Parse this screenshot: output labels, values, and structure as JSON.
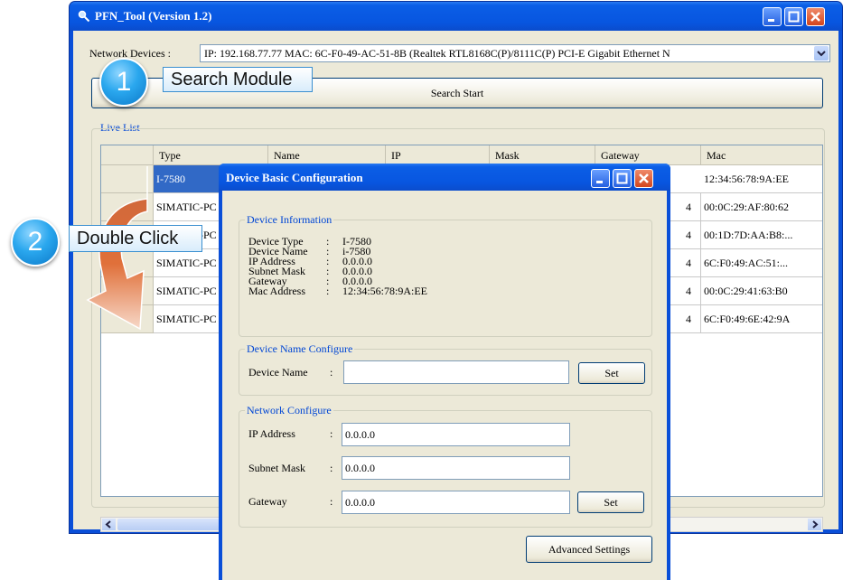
{
  "main_window": {
    "title": "PFN_Tool (Version 1.2)",
    "network_devices_label": "Network Devices :",
    "network_devices_value": "IP: 192.168.77.77  MAC: 6C-F0-49-AC-51-8B (Realtek RTL8168C(P)/8111C(P) PCI-E Gigabit Ethernet N",
    "search_button": "Search Start",
    "live_list_label": "Live List",
    "columns": [
      "Type",
      "Name",
      "IP",
      "Mask",
      "Gateway",
      "Mac"
    ],
    "rows": [
      {
        "type": "I-7580",
        "mac": "12:34:56:78:9A:EE",
        "gw_frag": ""
      },
      {
        "type": "SIMATIC-PC",
        "mac": "00:0C:29:AF:80:62",
        "gw_frag": "4"
      },
      {
        "type": "SIMATIC-PC",
        "mac": "00:1D:7D:AA:B8:...",
        "gw_frag": "4"
      },
      {
        "type": "SIMATIC-PC",
        "mac": "6C:F0:49:AC:51:...",
        "gw_frag": "4"
      },
      {
        "type": "SIMATIC-PC",
        "mac": "00:0C:29:41:63:B0",
        "gw_frag": "4"
      },
      {
        "type": "SIMATIC-PC",
        "mac": "6C:F0:49:6E:42:9A",
        "gw_frag": "4"
      }
    ]
  },
  "dialog": {
    "title": "Device Basic Configuration",
    "device_info_title": "Device Information",
    "info_labels": [
      "Device Type",
      "Device Name",
      "IP Address",
      "Subnet Mask",
      "Gateway",
      "Mac Address"
    ],
    "info_values": [
      "I-7580",
      "i-7580",
      "0.0.0.0",
      "0.0.0.0",
      "0.0.0.0",
      "12:34:56:78:9A:EE"
    ],
    "name_group_title": "Device Name Configure",
    "device_name_label": "Device Name",
    "device_name_value": "",
    "set_label": "Set",
    "network_group_title": "Network Configure",
    "ip_label": "IP Address",
    "ip_value": "0.0.0.0",
    "mask_label": "Subnet Mask",
    "mask_value": "0.0.0.0",
    "gateway_label": "Gateway",
    "gateway_value": "0.0.0.0",
    "advanced_label": "Advanced Settings",
    "colon": ":"
  },
  "annotations": {
    "step1_number": "1",
    "step1_text": "Search Module",
    "step2_number": "2",
    "step2_text": "Double Click"
  },
  "colors": {
    "titlebar": "#0856e0",
    "selection": "#3169c6",
    "group_title": "#0046d5",
    "arrow_orange": "#e0703a"
  }
}
